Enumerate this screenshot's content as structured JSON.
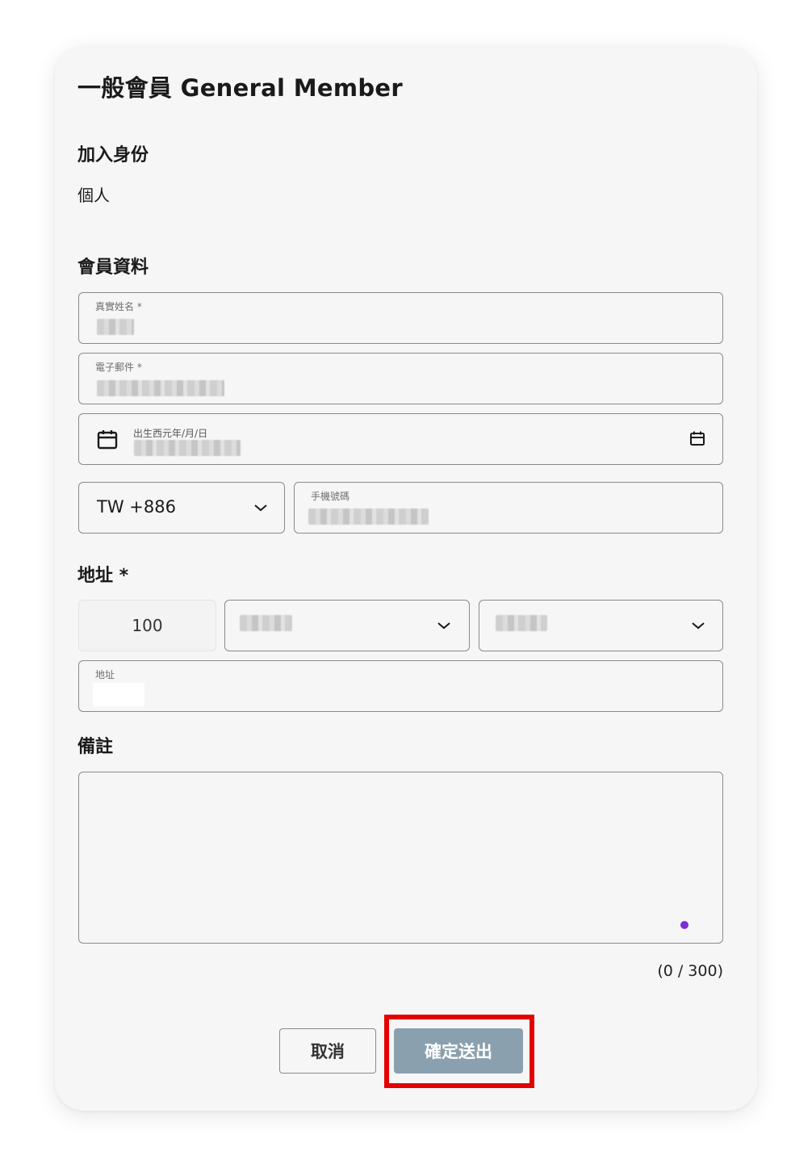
{
  "form": {
    "title": "一般會員 General Member",
    "identity_heading": "加入身份",
    "identity_value": "個人",
    "member_heading": "會員資料",
    "fields": {
      "name_label": "真實姓名 *",
      "email_label": "電子郵件 *",
      "birthday_label": "出生西元年/月/日",
      "phone_label": "手機號碼"
    },
    "country_code": "TW +886",
    "address_heading": "地址 *",
    "zip_code": "100",
    "address_label": "地址",
    "notes_heading": "備註",
    "notes_counter": "(0 / 300)"
  },
  "actions": {
    "cancel_label": "取消",
    "submit_label": "確定送出"
  },
  "colors": {
    "card_bg": "#f6f6f6",
    "submit_bg": "#8aa0ae",
    "highlight_border": "#e50000",
    "accent_dot": "#7b2fd6"
  },
  "icons": {
    "birthday_left": "calendar-icon",
    "birthday_right": "calendar-icon",
    "select": "chevron-down-icon"
  }
}
